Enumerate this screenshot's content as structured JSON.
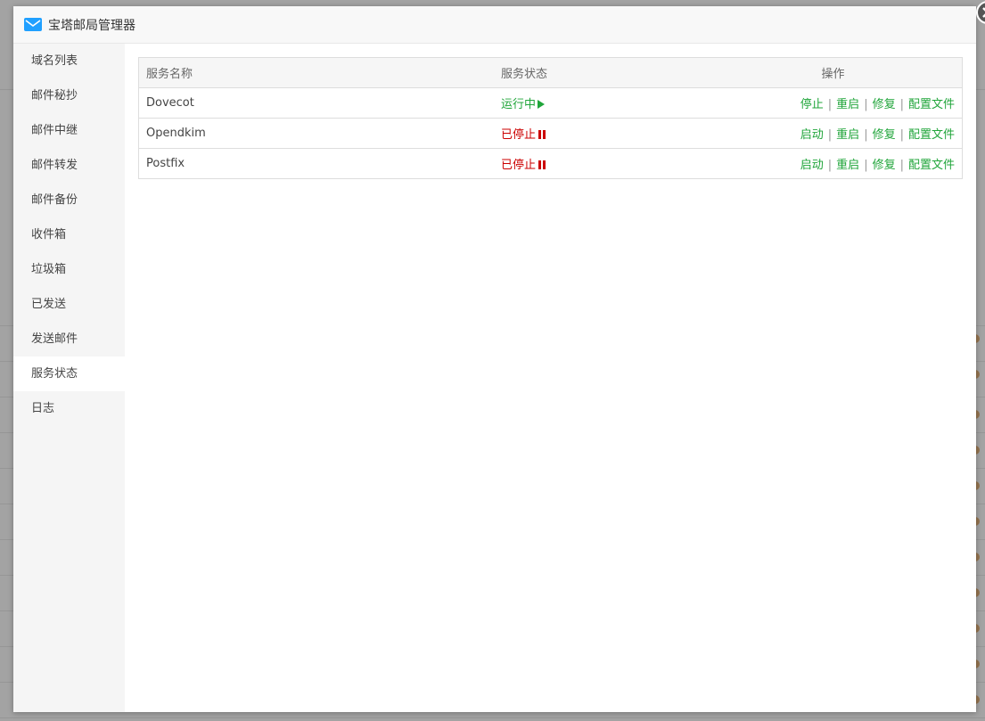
{
  "window": {
    "title": "宝塔邮局管理器"
  },
  "sidebar": {
    "items": [
      {
        "label": "域名列表"
      },
      {
        "label": "邮件秘抄"
      },
      {
        "label": "邮件中继"
      },
      {
        "label": "邮件转发"
      },
      {
        "label": "邮件备份"
      },
      {
        "label": "收件箱"
      },
      {
        "label": "垃圾箱"
      },
      {
        "label": "已发送"
      },
      {
        "label": "发送邮件"
      },
      {
        "label": "服务状态",
        "active": true
      },
      {
        "label": "日志"
      }
    ]
  },
  "table": {
    "headers": {
      "name": "服务名称",
      "status": "服务状态",
      "ops": "操作"
    },
    "rows": [
      {
        "name": "Dovecot",
        "status": "运行中",
        "running": true,
        "actions": [
          "停止",
          "重启",
          "修复",
          "配置文件"
        ]
      },
      {
        "name": "Opendkim",
        "status": "已停止",
        "running": false,
        "actions": [
          "启动",
          "重启",
          "修复",
          "配置文件"
        ]
      },
      {
        "name": "Postfix",
        "status": "已停止",
        "running": false,
        "actions": [
          "启动",
          "重启",
          "修复",
          "配置文件"
        ]
      }
    ]
  },
  "colors": {
    "accent": "#20a53a",
    "stopped": "#cc0000",
    "mail_icon": "#20a0ff"
  },
  "icons": {
    "title": "mail-icon",
    "close": "close-icon",
    "running": "play-icon",
    "stopped": "pause-icon"
  }
}
